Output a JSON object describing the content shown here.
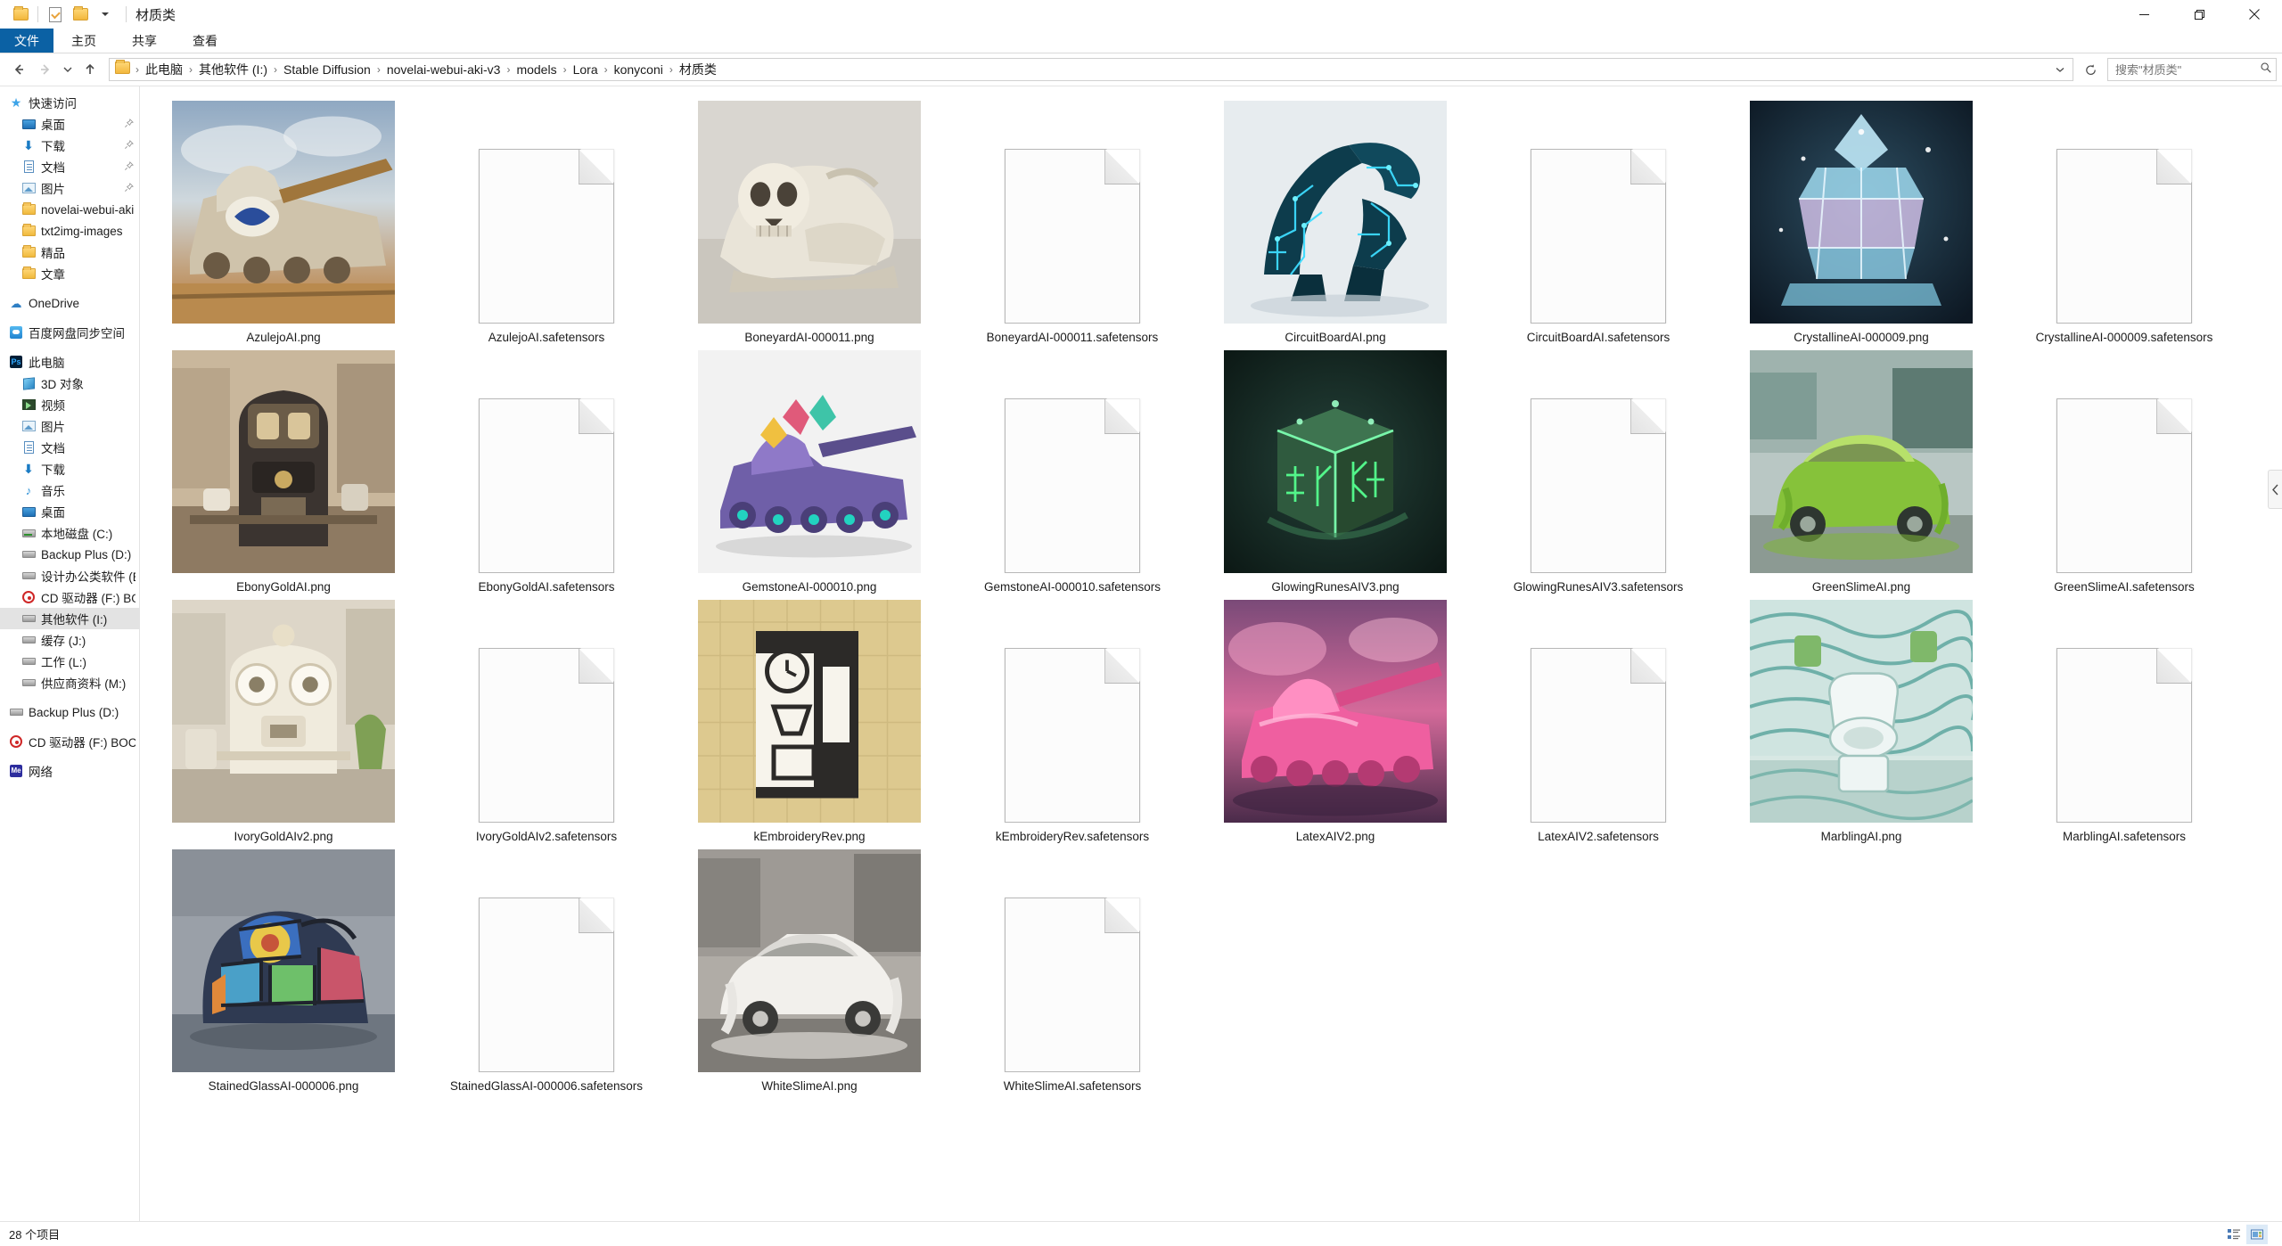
{
  "window": {
    "title": "材质类",
    "quick_access_toolbar": [
      {
        "name": "folder-properties-icon",
        "label": "属性"
      },
      {
        "name": "new-folder-icon",
        "label": "新建文件夹"
      },
      {
        "name": "customize-qat-caret-icon",
        "label": "自定义快速访问工具栏"
      }
    ],
    "controls": [
      {
        "name": "minimize-button",
        "label": "最小化"
      },
      {
        "name": "restore-button",
        "label": "向下还原"
      },
      {
        "name": "close-button",
        "label": "关闭"
      }
    ]
  },
  "ribbon": {
    "tabs": [
      {
        "label": "文件",
        "active": true
      },
      {
        "label": "主页",
        "active": false
      },
      {
        "label": "共享",
        "active": false
      },
      {
        "label": "查看",
        "active": false
      }
    ]
  },
  "address": {
    "back_label": "返回",
    "forward_label": "前进",
    "recent_label": "最近浏览的位置",
    "up_label": "上移一级",
    "refresh_label": "刷新",
    "crumbs": [
      "此电脑",
      "其他软件 (I:)",
      "Stable Diffusion",
      "novelai-webui-aki-v3",
      "models",
      "Lora",
      "konyconi",
      "材质类"
    ],
    "separator": "›"
  },
  "search": {
    "placeholder": "搜索\"材质类\"",
    "value": "",
    "icon": "search-icon"
  },
  "sidebar": {
    "groups": [
      {
        "name": "quick-access",
        "items": [
          {
            "label": "快速访问",
            "icon": "star-icon",
            "level": 0,
            "pinned": false,
            "selected": false
          },
          {
            "label": "桌面",
            "icon": "desktop-icon",
            "level": 1,
            "pinned": true,
            "selected": false
          },
          {
            "label": "下载",
            "icon": "downloads-icon",
            "level": 1,
            "pinned": true,
            "selected": false
          },
          {
            "label": "文档",
            "icon": "documents-icon",
            "level": 1,
            "pinned": true,
            "selected": false
          },
          {
            "label": "图片",
            "icon": "pictures-icon",
            "level": 1,
            "pinned": true,
            "selected": false
          },
          {
            "label": "novelai-webui-aki",
            "icon": "folder-icon",
            "level": 1,
            "pinned": false,
            "selected": false
          },
          {
            "label": "txt2img-images",
            "icon": "folder-icon",
            "level": 1,
            "pinned": false,
            "selected": false
          },
          {
            "label": "精品",
            "icon": "folder-icon",
            "level": 1,
            "pinned": false,
            "selected": false
          },
          {
            "label": "文章",
            "icon": "folder-icon",
            "level": 1,
            "pinned": false,
            "selected": false
          }
        ]
      },
      {
        "name": "onedrive",
        "items": [
          {
            "label": "OneDrive",
            "icon": "cloud-icon",
            "level": 0,
            "pinned": false,
            "selected": false
          }
        ]
      },
      {
        "name": "baidu-netdisk",
        "items": [
          {
            "label": "百度网盘同步空间",
            "icon": "baidu-netdisk-icon",
            "level": 0,
            "pinned": false,
            "selected": false
          }
        ]
      },
      {
        "name": "this-pc",
        "items": [
          {
            "label": "此电脑",
            "icon": "this-pc-icon",
            "level": 0,
            "pinned": false,
            "selected": false
          },
          {
            "label": "3D 对象",
            "icon": "3d-objects-icon",
            "level": 1,
            "pinned": false,
            "selected": false
          },
          {
            "label": "视频",
            "icon": "videos-icon",
            "level": 1,
            "pinned": false,
            "selected": false
          },
          {
            "label": "图片",
            "icon": "pictures-icon",
            "level": 1,
            "pinned": false,
            "selected": false
          },
          {
            "label": "文档",
            "icon": "documents-icon",
            "level": 1,
            "pinned": false,
            "selected": false
          },
          {
            "label": "下载",
            "icon": "downloads-icon",
            "level": 1,
            "pinned": false,
            "selected": false
          },
          {
            "label": "音乐",
            "icon": "music-icon",
            "level": 1,
            "pinned": false,
            "selected": false
          },
          {
            "label": "桌面",
            "icon": "desktop-icon",
            "level": 1,
            "pinned": false,
            "selected": false
          },
          {
            "label": "本地磁盘 (C:)",
            "icon": "system-drive-icon",
            "level": 1,
            "pinned": false,
            "selected": false
          },
          {
            "label": "Backup Plus (D:)",
            "icon": "drive-icon",
            "level": 1,
            "pinned": false,
            "selected": false
          },
          {
            "label": "设计办公类软件 (E:",
            "icon": "drive-icon",
            "level": 1,
            "pinned": false,
            "selected": false
          },
          {
            "label": "CD 驱动器 (F:) BOC",
            "icon": "cd-drive-icon",
            "level": 1,
            "pinned": false,
            "selected": false
          },
          {
            "label": "其他软件 (I:)",
            "icon": "drive-icon",
            "level": 1,
            "pinned": false,
            "selected": true
          },
          {
            "label": "缓存 (J:)",
            "icon": "drive-icon",
            "level": 1,
            "pinned": false,
            "selected": false
          },
          {
            "label": "工作 (L:)",
            "icon": "drive-icon",
            "level": 1,
            "pinned": false,
            "selected": false
          },
          {
            "label": "供应商资料 (M:)",
            "icon": "drive-icon",
            "level": 1,
            "pinned": false,
            "selected": false
          }
        ]
      },
      {
        "name": "drives",
        "items": [
          {
            "label": "Backup Plus (D:)",
            "icon": "drive-icon",
            "level": 0,
            "pinned": false,
            "selected": false
          },
          {
            "label": "CD 驱动器 (F:) BOCI",
            "icon": "cd-drive-icon",
            "level": 0,
            "pinned": false,
            "selected": false
          }
        ]
      },
      {
        "name": "network",
        "items": [
          {
            "label": "网络",
            "icon": "network-icon",
            "level": 0,
            "pinned": false,
            "selected": false
          }
        ]
      }
    ]
  },
  "files": [
    {
      "label": "AzulejoAI.png",
      "kind": "image",
      "thumb": "azulejo-tank"
    },
    {
      "label": "AzulejoAI.safetensors",
      "kind": "blank-document"
    },
    {
      "label": "BoneyardAI-000011.png",
      "kind": "image",
      "thumb": "boneyard-skull-shoe"
    },
    {
      "label": "BoneyardAI-000011.safetensors",
      "kind": "blank-document"
    },
    {
      "label": "CircuitBoardAI.png",
      "kind": "image",
      "thumb": "circuitboard-heels"
    },
    {
      "label": "CircuitBoardAI.safetensors",
      "kind": "blank-document"
    },
    {
      "label": "CrystallineAI-000009.png",
      "kind": "image",
      "thumb": "crystalline-carousel"
    },
    {
      "label": "CrystallineAI-000009.safetensors",
      "kind": "blank-document"
    },
    {
      "label": "EbonyGoldAI.png",
      "kind": "image",
      "thumb": "ebonygold-espresso"
    },
    {
      "label": "EbonyGoldAI.safetensors",
      "kind": "blank-document"
    },
    {
      "label": "GemstoneAI-000010.png",
      "kind": "image",
      "thumb": "gemstone-tank"
    },
    {
      "label": "GemstoneAI-000010.safetensors",
      "kind": "blank-document"
    },
    {
      "label": "GlowingRunesAIV3.png",
      "kind": "image",
      "thumb": "glowingrunes-chest"
    },
    {
      "label": "GlowingRunesAIV3.safetensors",
      "kind": "blank-document"
    },
    {
      "label": "GreenSlimeAI.png",
      "kind": "image",
      "thumb": "greenslime-car"
    },
    {
      "label": "GreenSlimeAI.safetensors",
      "kind": "blank-document"
    },
    {
      "label": "IvoryGoldAIv2.png",
      "kind": "image",
      "thumb": "ivorygold-machine"
    },
    {
      "label": "IvoryGoldAIv2.safetensors",
      "kind": "blank-document"
    },
    {
      "label": "kEmbroideryRev.png",
      "kind": "image",
      "thumb": "embroidery-coffeemaker"
    },
    {
      "label": "kEmbroideryRev.safetensors",
      "kind": "blank-document"
    },
    {
      "label": "LatexAIV2.png",
      "kind": "image",
      "thumb": "latex-pink-tank"
    },
    {
      "label": "LatexAIV2.safetensors",
      "kind": "blank-document"
    },
    {
      "label": "MarblingAI.png",
      "kind": "image",
      "thumb": "marbling-toilet"
    },
    {
      "label": "MarblingAI.safetensors",
      "kind": "blank-document"
    },
    {
      "label": "StainedGlassAI-000006.png",
      "kind": "image",
      "thumb": "stainedglass-elephant"
    },
    {
      "label": "StainedGlassAI-000006.safetensors",
      "kind": "blank-document"
    },
    {
      "label": "WhiteSlimeAI.png",
      "kind": "image",
      "thumb": "whiteslime-car"
    },
    {
      "label": "WhiteSlimeAI.safetensors",
      "kind": "blank-document"
    }
  ],
  "status": {
    "item_count_text": "28 个项目",
    "views": [
      {
        "name": "details-view-button",
        "label": "详细信息",
        "active": false
      },
      {
        "name": "large-icons-view-button",
        "label": "大图标",
        "active": true
      }
    ]
  },
  "panel": {
    "collapse_label": "展开"
  },
  "colors": {
    "accent": "#0b61a4",
    "selection": "#e3e3e3",
    "hover": "#e8f2fb",
    "border": "#e3e3e3"
  }
}
